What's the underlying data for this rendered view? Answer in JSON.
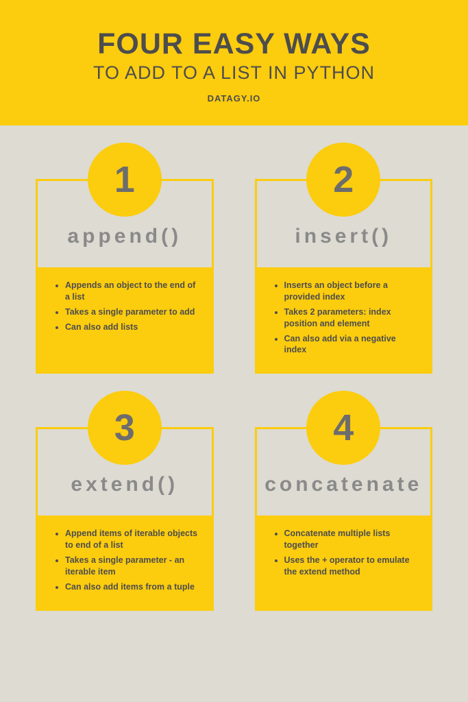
{
  "header": {
    "title": "FOUR EASY WAYS",
    "subtitle": "TO ADD TO A LIST IN PYTHON",
    "brand": "DATAGY.IO"
  },
  "cards": [
    {
      "num": "1",
      "title": "append()",
      "points": [
        "Appends an object to the end of a list",
        "Takes a single parameter to add",
        "Can also add lists"
      ]
    },
    {
      "num": "2",
      "title": "insert()",
      "points": [
        "Inserts an object before a provided index",
        "Takes 2 parameters: index position and element",
        "Can also add via a negative index"
      ]
    },
    {
      "num": "3",
      "title": "extend()",
      "points": [
        "Append items of iterable objects to end of a list",
        "Takes a single parameter - an iterable item",
        "Can also add items from a tuple"
      ]
    },
    {
      "num": "4",
      "title": "concatenate",
      "points": [
        "Concatenate multiple lists together",
        "Uses the + operator to emulate the extend method"
      ]
    }
  ]
}
